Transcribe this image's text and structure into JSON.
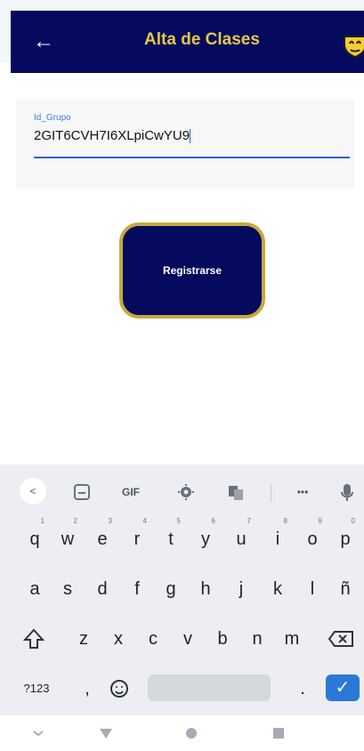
{
  "appbar": {
    "title": "Alta de Clases",
    "back_icon": "arrow-left-icon",
    "logo_icon": "shield-logo-icon"
  },
  "form": {
    "field_label": "Id_Grupo",
    "field_value": "2GIT6CVH7I6XLpiCwYU9",
    "button_label": "Registrarse"
  },
  "keyboard": {
    "toolbar": [
      "back-icon",
      "sticker-icon",
      "GIF",
      "gear-icon",
      "translate-icon",
      "more-icon",
      "mic-icon"
    ],
    "gif_label": "GIF",
    "more_label": "•••",
    "row1": [
      "q",
      "w",
      "e",
      "r",
      "t",
      "y",
      "u",
      "i",
      "o",
      "p"
    ],
    "row1_hints": [
      "1",
      "2",
      "3",
      "4",
      "5",
      "6",
      "7",
      "8",
      "9",
      "0"
    ],
    "row2": [
      "a",
      "s",
      "d",
      "f",
      "g",
      "h",
      "j",
      "k",
      "l",
      "ñ"
    ],
    "row3": [
      "z",
      "x",
      "c",
      "v",
      "b",
      "n",
      "m"
    ],
    "row4": {
      "numbers": "?123",
      "comma": ",",
      "period": "."
    }
  },
  "navigation": {
    "back": "nav-back-icon",
    "home": "nav-home-icon",
    "recents": "nav-recents-icon"
  },
  "colors": {
    "primary": "#060a5e",
    "accent": "#c6a93c",
    "title": "#e3c945",
    "field_line": "#2a62d8"
  }
}
